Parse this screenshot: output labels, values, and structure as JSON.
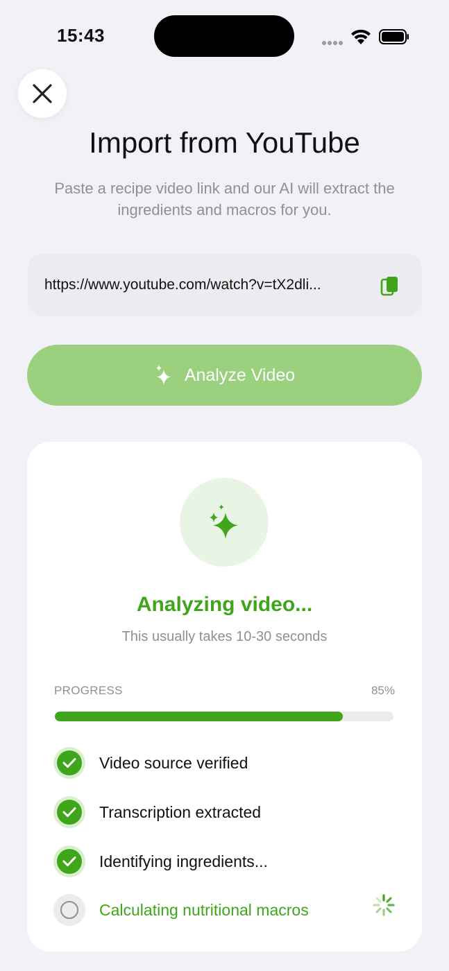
{
  "status_bar": {
    "time": "15:43"
  },
  "header": {
    "title": "Import from YouTube",
    "subtitle": "Paste a recipe video link and our AI will extract the ingredients and macros for you."
  },
  "url_input": {
    "value": "https://www.youtube.com/watch?v=tX2dli..."
  },
  "analyze_button": {
    "label": "Analyze Video"
  },
  "analysis": {
    "title": "Analyzing video...",
    "subtitle": "This usually takes 10-30 seconds",
    "progress_label": "PROGRESS",
    "progress_text": "85%",
    "progress_value": 0.85,
    "steps": [
      {
        "label": "Video source verified",
        "state": "done"
      },
      {
        "label": "Transcription extracted",
        "state": "done"
      },
      {
        "label": "Identifying ingredients...",
        "state": "done"
      },
      {
        "label": "Calculating nutritional macros",
        "state": "in_progress"
      }
    ]
  },
  "colors": {
    "accent": "#3fa51b",
    "button_disabled": "#9bd07f",
    "background": "#f2f1f7",
    "muted_text": "#8f8f96"
  },
  "icons": [
    "close-icon",
    "paste-icon",
    "sparkles-icon",
    "check-icon",
    "spinner-icon"
  ]
}
